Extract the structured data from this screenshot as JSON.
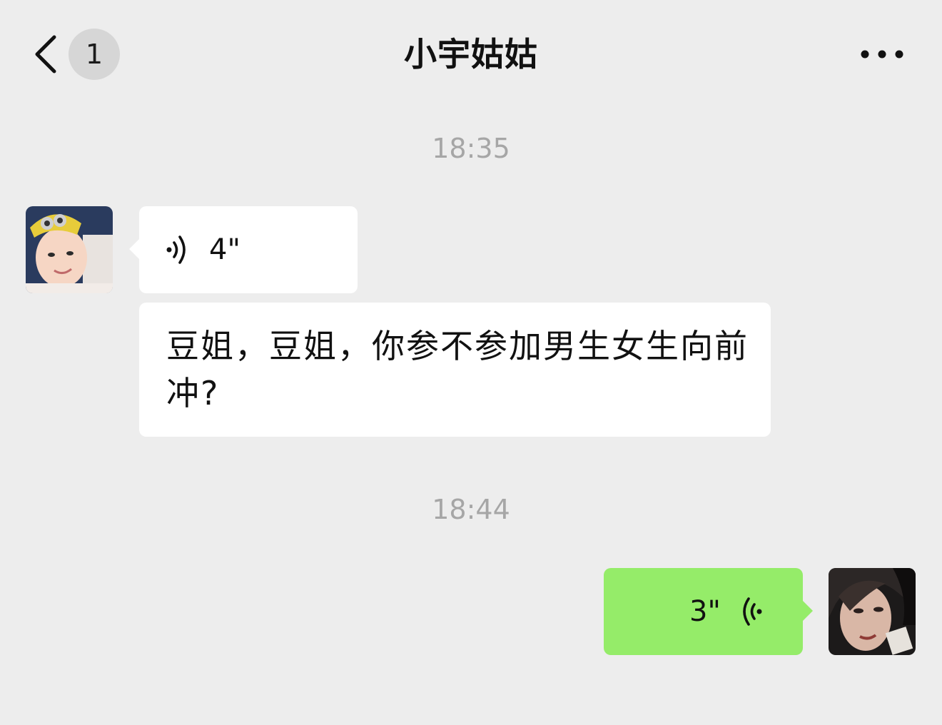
{
  "header": {
    "unread_count": "1",
    "title": "小宇姑姑",
    "back_icon": "chevron-left-icon",
    "more_icon": "more-dots-icon"
  },
  "messages": [
    {
      "type": "timestamp",
      "text": "18:35"
    },
    {
      "type": "voice",
      "direction": "incoming",
      "duration": "4\""
    },
    {
      "type": "text",
      "direction": "incoming",
      "text": "豆姐，豆姐，你参不参加男生女生向前冲?"
    },
    {
      "type": "timestamp",
      "text": "18:44"
    },
    {
      "type": "voice",
      "direction": "outgoing",
      "duration": "3\""
    }
  ],
  "colors": {
    "background": "#ededed",
    "incoming_bubble": "#ffffff",
    "outgoing_bubble": "#95ec69",
    "timestamp_text": "#a6a6a6",
    "badge_bg": "#d6d6d6"
  }
}
